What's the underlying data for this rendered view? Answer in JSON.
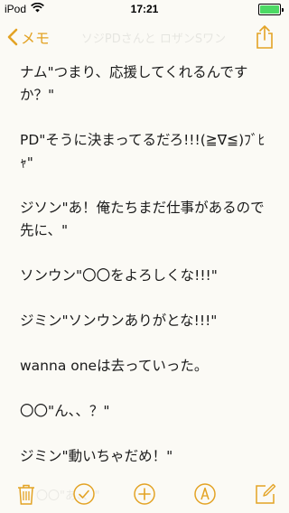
{
  "status_bar": {
    "device": "iPod",
    "time": "17:21",
    "battery_level": 1.0,
    "battery_color": "#4cd964"
  },
  "nav": {
    "back_label": "メモ",
    "ghost_title": "ソジPDさんと ロザンSワン",
    "back_icon": "chevron-left-icon",
    "share_icon": "share-icon",
    "accent_color": "#e3a325"
  },
  "note": {
    "paragraphs": [
      "ナム\"つまり、応援してくれるんですか？\"",
      "PD\"そうに決まってるだろ!!!(≧∇≦)ﾌﾞﾋｬ\"",
      "ジソン\"あ！俺たちまだ仕事があるので先に、\"",
      "ソンウン\"〇〇をよろしくな!!!\"",
      "ジミン\"ソンウンありがとな!!!\"",
      "wanna oneは去っていった。",
      "〇〇\"ん、、？\"",
      "ジミン\"動いちゃだめ！\""
    ],
    "ghost_line": "〇〇\"あ、、\""
  },
  "toolbar": {
    "items": [
      "trash-icon",
      "checklist-icon",
      "add-icon",
      "markup-icon",
      "compose-icon"
    ]
  }
}
